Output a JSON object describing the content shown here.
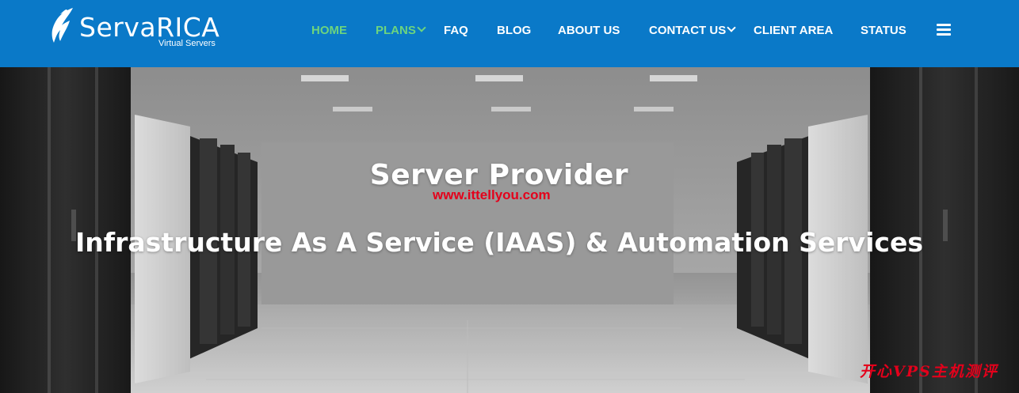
{
  "brand": {
    "name": "ServaRICA",
    "tagline": "Virtual Servers"
  },
  "nav": {
    "items": [
      {
        "label": "HOME",
        "active": true,
        "dropdown": false
      },
      {
        "label": "PLANS",
        "active": true,
        "dropdown": true
      },
      {
        "label": "FAQ",
        "active": false,
        "dropdown": false
      },
      {
        "label": "BLOG",
        "active": false,
        "dropdown": false
      },
      {
        "label": "ABOUT US",
        "active": false,
        "dropdown": false
      },
      {
        "label": "CONTACT US",
        "active": false,
        "dropdown": true
      },
      {
        "label": "CLIENT AREA",
        "active": false,
        "dropdown": false
      },
      {
        "label": "STATUS",
        "active": false,
        "dropdown": false
      }
    ],
    "menu_icon": "hamburger-icon"
  },
  "hero": {
    "title": "Server Provider",
    "subtitle": "Infrastructure As A Service (IAAS) & Automation Services"
  },
  "watermarks": {
    "url": "www.ittellyou.com",
    "cn": "开心VPS主机测评"
  },
  "colors": {
    "header_bg": "#0a79c8",
    "nav_active": "#6dd47e",
    "nav_text": "#ffffff",
    "watermark": "#e4001b"
  }
}
